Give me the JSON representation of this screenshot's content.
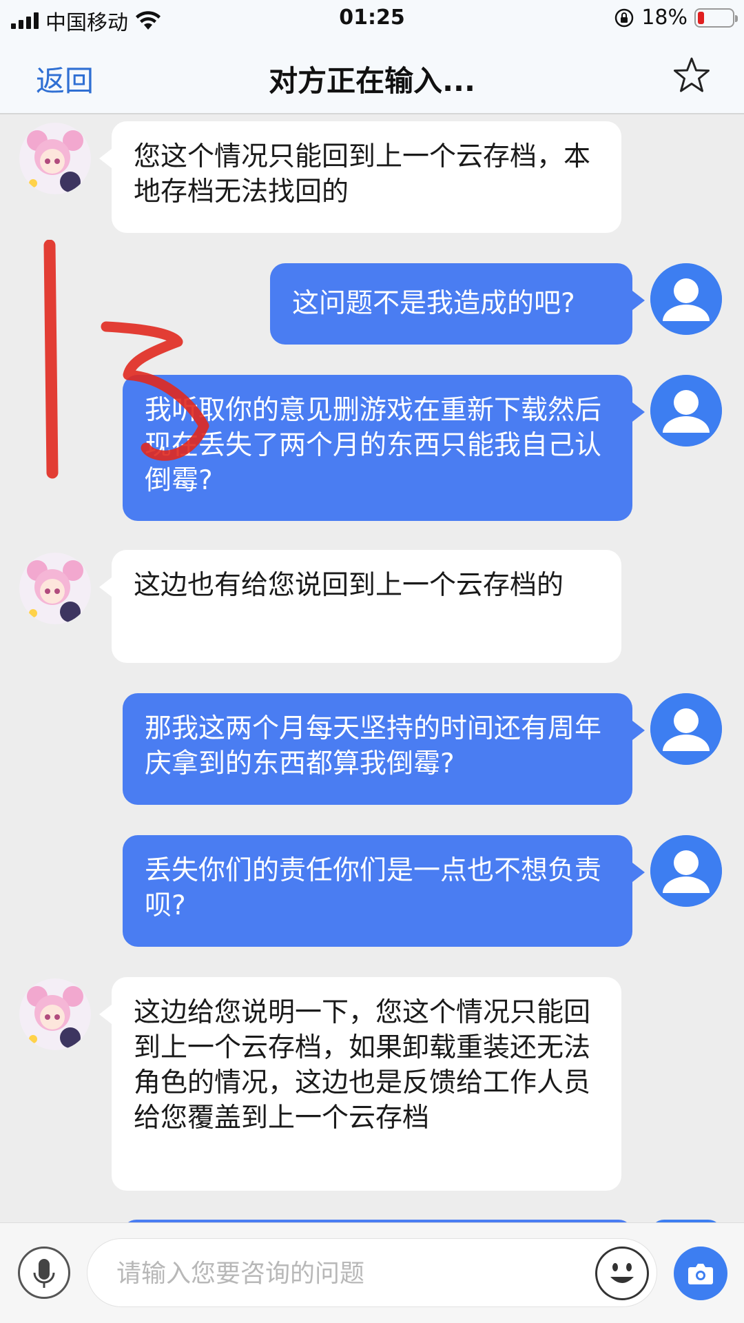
{
  "status_bar": {
    "carrier": "中国移动",
    "time": "01:25",
    "battery_percent": "18%",
    "battery_level": 0.18,
    "icons": [
      "signal-icon",
      "wifi-icon",
      "orientation-lock-icon",
      "battery-icon"
    ]
  },
  "nav": {
    "back_label": "返回",
    "title": "对方正在输入...",
    "favorite_icon": "star-outline-icon"
  },
  "annotation": {
    "handwritten_text": "13",
    "color": "#e0291f"
  },
  "messages": [
    {
      "sender": "agent",
      "text": "您这个情况只能回到上一个云存档，本地存档无法找回的"
    },
    {
      "sender": "user",
      "text": "这问题不是我造成的吧?"
    },
    {
      "sender": "user",
      "text": "我听取你的意见删游戏在重新下载然后现在丢失了两个月的东西只能我自己认倒霉?"
    },
    {
      "sender": "agent",
      "text": "这边也有给您说回到上一个云存档的"
    },
    {
      "sender": "user",
      "text": "那我这两个月每天坚持的时间还有周年庆拿到的东西都算我倒霉?"
    },
    {
      "sender": "user",
      "text": "丢失你们的责任你们是一点也不想负责呗?"
    },
    {
      "sender": "agent",
      "text": "这边给您说明一下，您这个情况只能回到上一个云存档，如果卸载重装还无法角色的情况，这边也是反馈给工作人员给您覆盖到上一个云存档"
    }
  ],
  "input": {
    "placeholder": "请输入您要咨询的问题",
    "value": ""
  },
  "colors": {
    "accent": "#2f6fd3",
    "user_bubble": "#4a7df2",
    "agent_bubble": "#ffffff",
    "chat_bg": "#ededed",
    "annotation_red": "#e0291f"
  }
}
